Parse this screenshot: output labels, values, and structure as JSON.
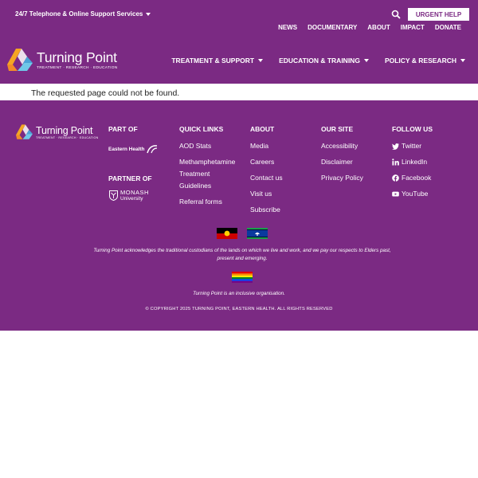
{
  "header": {
    "support_label": "24/7 Telephone & Online Support Services",
    "urgent_label": "URGENT HELP",
    "utility_nav": [
      "NEWS",
      "DOCUMENTARY",
      "ABOUT",
      "IMPACT",
      "DONATE"
    ],
    "logo_name": "Turning Point",
    "logo_tagline": "TREATMENT · RESEARCH · EDUCATION",
    "main_nav": [
      "TREATMENT & SUPPORT",
      "EDUCATION & TRAINING",
      "POLICY & RESEARCH"
    ]
  },
  "main": {
    "message": "The requested page could not be found."
  },
  "footer": {
    "logo_name": "Turning Point",
    "logo_tagline": "TREATMENT · RESEARCH · EDUCATION",
    "part_of_heading": "PART OF",
    "eastern_health_logo_text": "Eastern Health",
    "partner_of_heading": "PARTNER OF",
    "monash_logo_line1": "MONASH",
    "monash_logo_line2": "University",
    "quick_links": {
      "heading": "QUICK LINKS",
      "items": [
        "AOD Stats",
        "Methamphetamine Treatment Guidelines",
        "Referral forms"
      ]
    },
    "about": {
      "heading": "ABOUT",
      "items": [
        "Media",
        "Careers",
        "Contact us",
        "Visit us",
        "Subscribe"
      ]
    },
    "our_site": {
      "heading": "OUR SITE",
      "items": [
        "Accessibility",
        "Disclaimer",
        "Privacy Policy"
      ]
    },
    "follow_us": {
      "heading": "FOLLOW US",
      "items": [
        {
          "label": "Twitter",
          "icon": "twitter-icon"
        },
        {
          "label": "LinkedIn",
          "icon": "linkedin-icon"
        },
        {
          "label": "Facebook",
          "icon": "facebook-icon"
        },
        {
          "label": "YouTube",
          "icon": "youtube-icon"
        }
      ]
    },
    "acknowledgement": "Turning Point acknowledges the traditional custodians of the lands on which we live and work, and we pay our respects to Elders past, present and emerging.",
    "inclusive": "Turning Point is an inclusive organisation.",
    "copyright": "© COPYRIGHT 2025 TURNING POINT, EASTERN HEALTH. ALL RIGHTS RESERVED"
  },
  "colors": {
    "brand_purple": "#7b2a83",
    "white": "#ffffff"
  }
}
